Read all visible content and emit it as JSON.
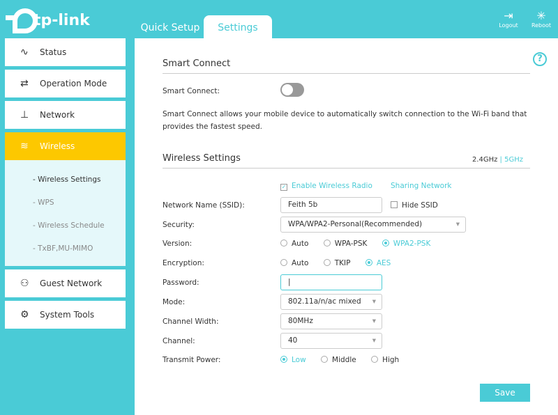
{
  "brand": "tp-link",
  "tabs": [
    "Quick Setup",
    "Settings"
  ],
  "top": {
    "logout": "Logout",
    "reboot": "Reboot"
  },
  "sidebar": {
    "items": [
      "Status",
      "Operation Mode",
      "Network",
      "Wireless",
      "Guest Network",
      "System Tools"
    ],
    "wireless_sub": [
      "- Wireless Settings",
      "- WPS",
      "- Wireless Schedule",
      "- TxBF,MU-MIMO"
    ]
  },
  "smart": {
    "title": "Smart Connect",
    "label": "Smart Connect:",
    "desc": "Smart Connect allows your mobile device to automatically switch connection to the Wi-Fi band that provides the fastest speed."
  },
  "wireless": {
    "title": "Wireless Settings",
    "band1": "2.4GHz",
    "sep": "|",
    "band2": "5GHz",
    "enable": "Enable Wireless Radio",
    "sharing": "Sharing Network",
    "ssid_label": "Network Name (SSID):",
    "ssid": "Feith 5b",
    "hide": "Hide SSID",
    "security_label": "Security:",
    "security": "WPA/WPA2-Personal(Recommended)",
    "version_label": "Version:",
    "version_opts": [
      "Auto",
      "WPA-PSK",
      "WPA2-PSK"
    ],
    "enc_label": "Encryption:",
    "enc_opts": [
      "Auto",
      "TKIP",
      "AES"
    ],
    "password_label": "Password:",
    "password": "|",
    "mode_label": "Mode:",
    "mode": "802.11a/n/ac mixed",
    "width_label": "Channel Width:",
    "width": "80MHz",
    "channel_label": "Channel:",
    "channel": "40",
    "power_label": "Transmit Power:",
    "power_opts": [
      "Low",
      "Middle",
      "High"
    ]
  },
  "save": "Save"
}
